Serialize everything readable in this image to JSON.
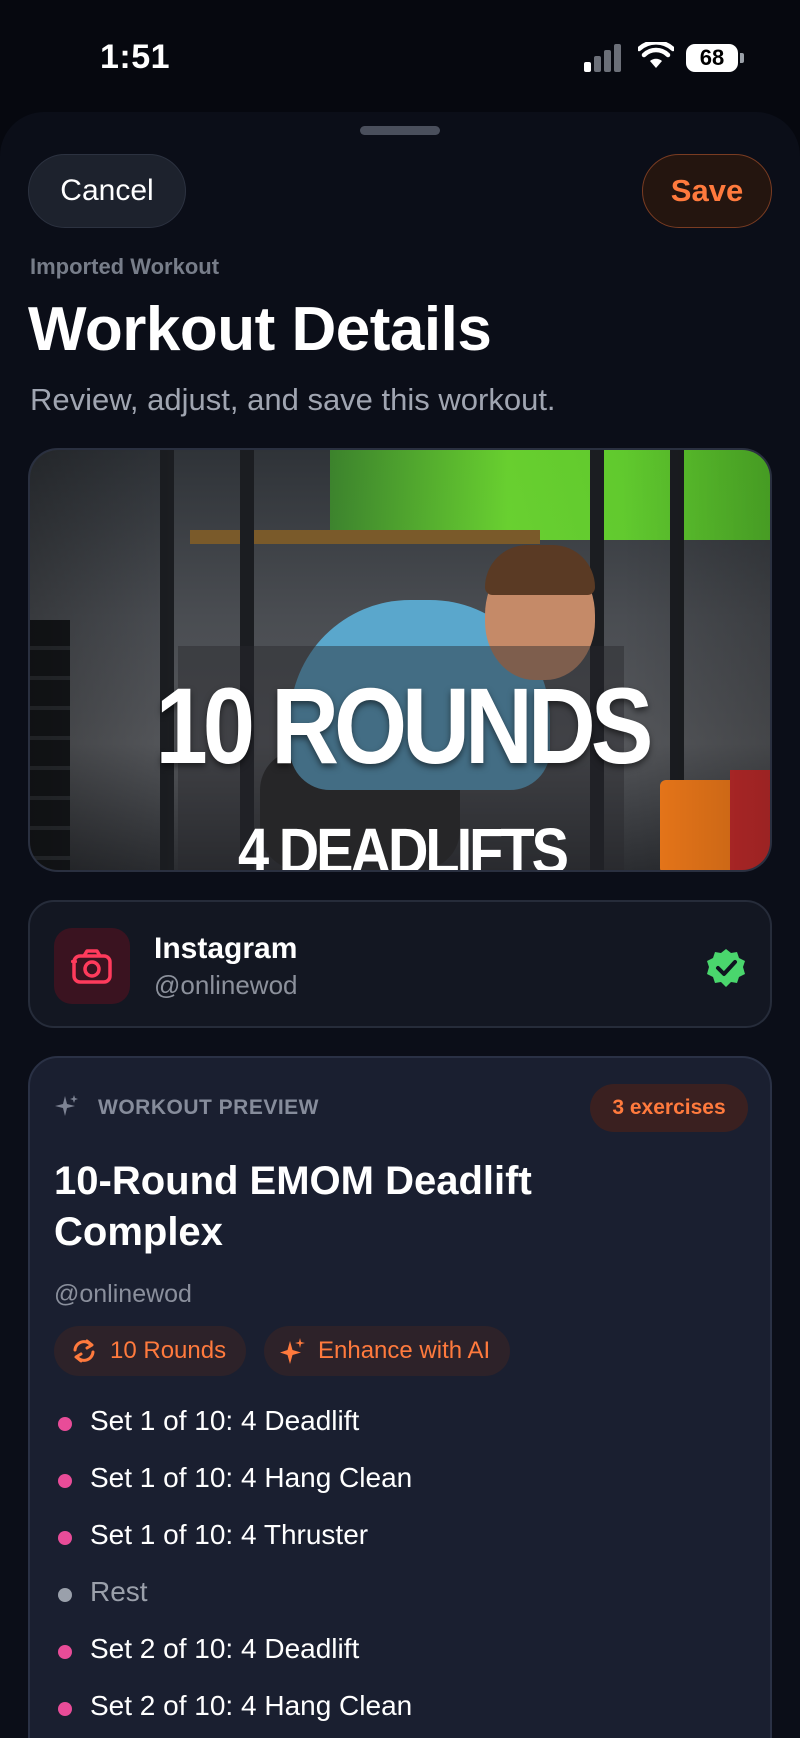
{
  "status_bar": {
    "time": "1:51",
    "battery": "68"
  },
  "header": {
    "cancel_label": "Cancel",
    "save_label": "Save",
    "eyebrow": "Imported Workout",
    "title": "Workout Details",
    "subtitle": "Review, adjust, and save this workout."
  },
  "hero": {
    "line1": "10 ROUNDS",
    "line2": "4 DEADLIFTS"
  },
  "source": {
    "platform": "Instagram",
    "handle": "@onlinewod",
    "icon": "camera-icon",
    "verified_icon": "verified-check-icon"
  },
  "preview": {
    "label": "WORKOUT PREVIEW",
    "exercise_count": "3 exercises",
    "title": "10-Round EMOM Deadlift Complex",
    "author": "@onlinewod",
    "rounds_chip": "10 Rounds",
    "ai_chip": "Enhance with AI",
    "steps": [
      "Set 1 of 10: 4 Deadlift",
      "Set 1 of 10: 4 Hang Clean",
      "Set 1 of 10: 4 Thruster",
      "Rest",
      "Set 2 of 10: 4 Deadlift",
      "Set 2 of 10: 4 Hang Clean"
    ]
  },
  "colors": {
    "accent": "#ff7a3d",
    "bullet": "#e84c98",
    "verified": "#4ad66d"
  }
}
